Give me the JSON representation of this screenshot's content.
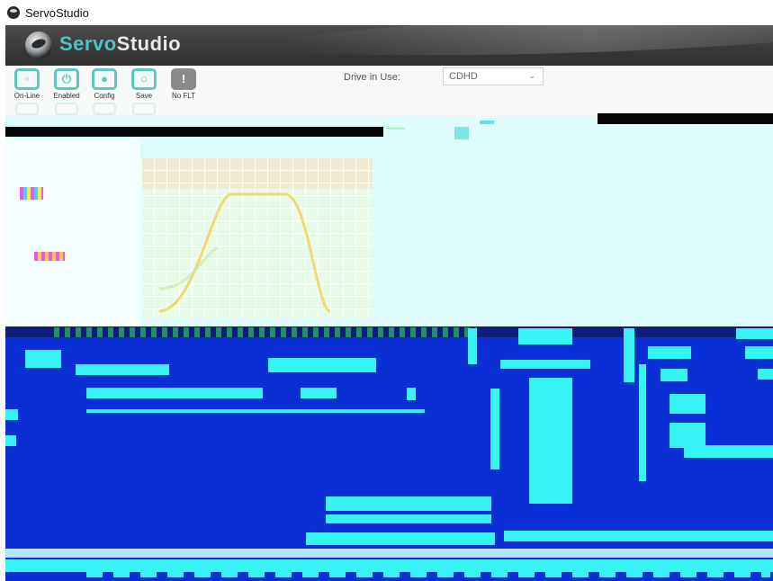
{
  "window": {
    "title": "ServoStudio"
  },
  "banner": {
    "logo_part1": "Servo",
    "logo_part2": "Studio"
  },
  "toolbar": {
    "buttons": [
      {
        "label": "On-Line",
        "icon": "plug-icon"
      },
      {
        "label": "Enabled",
        "icon": "power-icon"
      },
      {
        "label": "Config",
        "icon": "config-icon"
      },
      {
        "label": "Save",
        "icon": "save-icon"
      },
      {
        "label": "No FLT",
        "icon": "fault-icon"
      }
    ]
  },
  "drive": {
    "label": "Drive in Use:",
    "selected": "CDHD"
  },
  "colors": {
    "accent": "#5fc7bd",
    "banner": "#3a3a3a",
    "glitch_blue": "#0a2fd4",
    "glitch_cyan": "#37f3f3"
  }
}
